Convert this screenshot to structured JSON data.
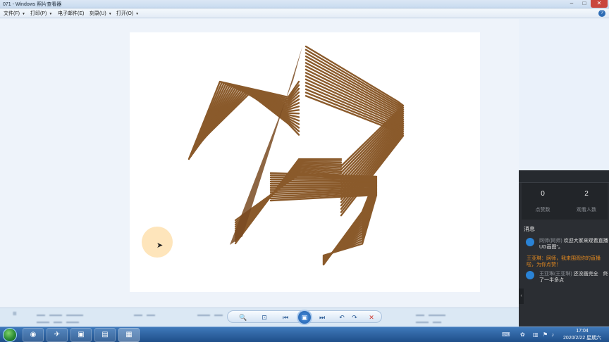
{
  "window": {
    "title": "071 - Windows 照片查看器",
    "controls": {
      "minimize": "–",
      "maximize": "□",
      "close": "✕"
    }
  },
  "menu": {
    "items": [
      {
        "label": "文件(F)"
      },
      {
        "label": "打印(P)"
      },
      {
        "label": "电子邮件(E)"
      },
      {
        "label": "刻录(U)"
      },
      {
        "label": "打开(O)"
      }
    ],
    "help": "?"
  },
  "image": {
    "description_icon": "wire-star-coil-model",
    "wire_color": "#8a5a2b"
  },
  "side_panel": {
    "stats": [
      {
        "value": "0",
        "label": "点赞数"
      },
      {
        "value": "2",
        "label": "观看人数"
      }
    ],
    "messages_title": "消息",
    "messages": [
      {
        "user": "网师(网师)",
        "text": "欢迎大家来观看直播UG画图\"。",
        "type": "user"
      },
      {
        "text": "王亚琳：网师，我来围观你的直播啦，为你点赞！",
        "type": "notice"
      },
      {
        "user": "王亚琳(王亚琳)",
        "text": "还没画完全　终了一半多点",
        "type": "user"
      }
    ]
  },
  "controls": {
    "zoom": "🔍",
    "fit": "⊡",
    "prev": "⏮",
    "slideshow": "▣",
    "next": "⏭",
    "rotate_ccw": "↶",
    "rotate_cw": "↷",
    "delete": "✕"
  },
  "taskbar": {
    "time": "17:04",
    "date": "2020/2/22 星期六"
  },
  "colors": {
    "accent": "#2f6db5",
    "panel_bg": "#2b2e33",
    "notice": "#e58a1f",
    "taskbar": "#1f4f8a"
  }
}
